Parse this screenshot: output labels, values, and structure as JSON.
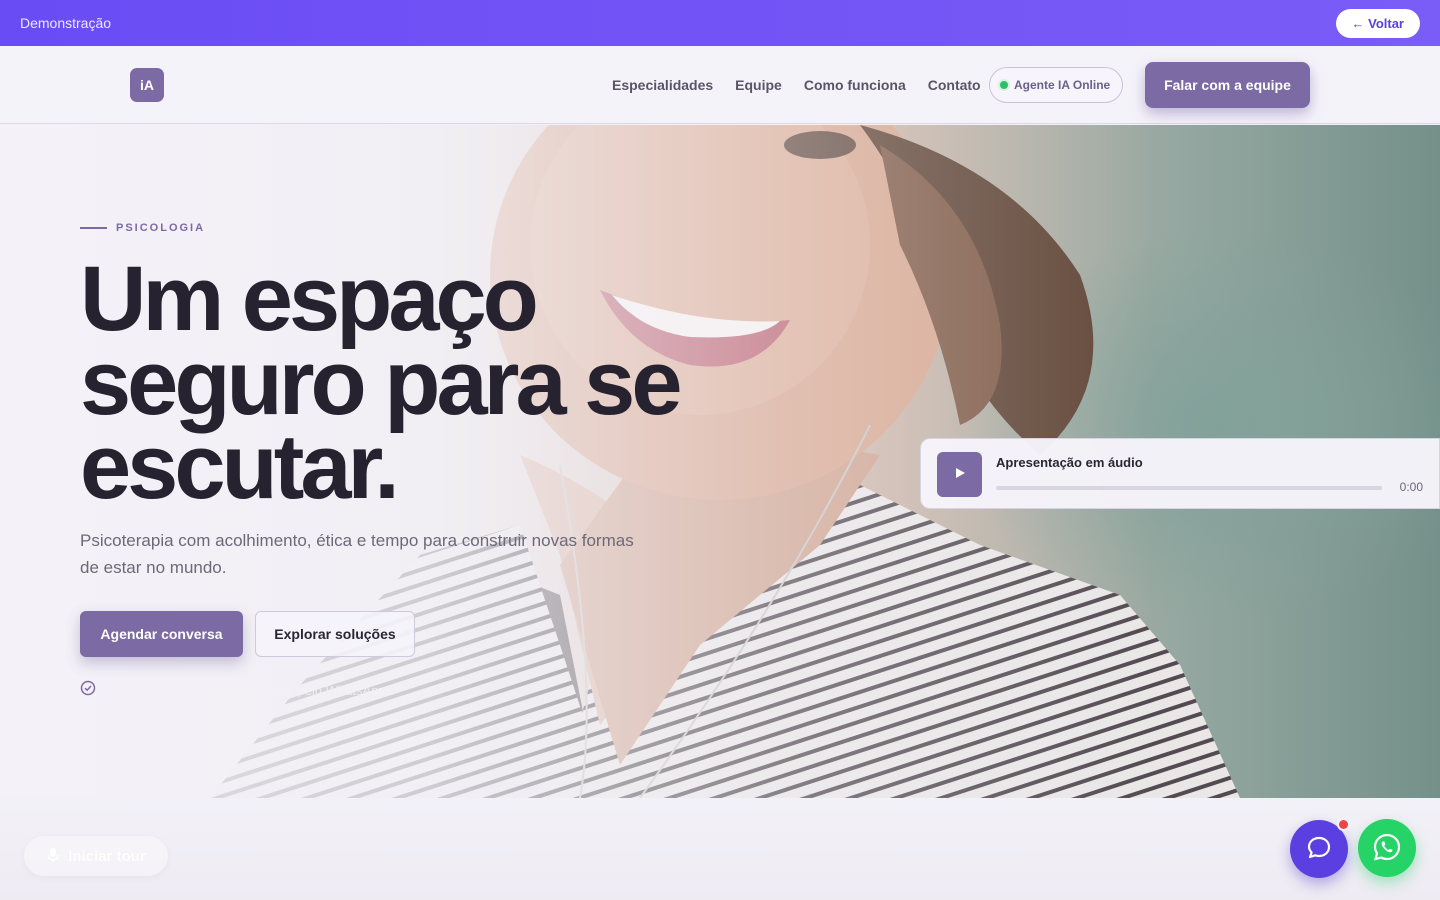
{
  "demo_bar": {
    "title": "Demonstração",
    "back_label": "← Voltar"
  },
  "header": {
    "logo_text": "iA",
    "nav": [
      {
        "label": "Especialidades"
      },
      {
        "label": "Equipe"
      },
      {
        "label": "Como funciona"
      },
      {
        "label": "Contato"
      }
    ],
    "agent_status": "Agente IA Online",
    "cta_label": "Falar com a equipe"
  },
  "hero": {
    "eyebrow": "PSICOLOGIA",
    "headline_lines": [
      "Um espaço",
      "seguro para se",
      "escutar."
    ],
    "subtext": "Psicoterapia com acolhimento, ética e tempo para construir novas formas de estar no mundo.",
    "primary_cta": "Agendar conversa",
    "secondary_cta": "Explorar soluções",
    "note": "Atendimento humano e resposta pelo WhatsApp"
  },
  "audio": {
    "title": "Apresentação em áudio",
    "time": "0:00",
    "progress": 0
  },
  "bottom": {
    "tour_label": "Iniciar tour"
  },
  "icons": {
    "play": "play-icon",
    "check": "check-circle-icon",
    "mic": "microphone-icon",
    "chat": "chat-bubble-icon",
    "whatsapp": "whatsapp-icon"
  },
  "colors": {
    "brand": "#7b6aa3",
    "demo_bar": "#6a4cf5",
    "chat_fab": "#5b3fe0",
    "whatsapp": "#25d366",
    "online": "#2fbf6a",
    "headline": "#27222f"
  }
}
